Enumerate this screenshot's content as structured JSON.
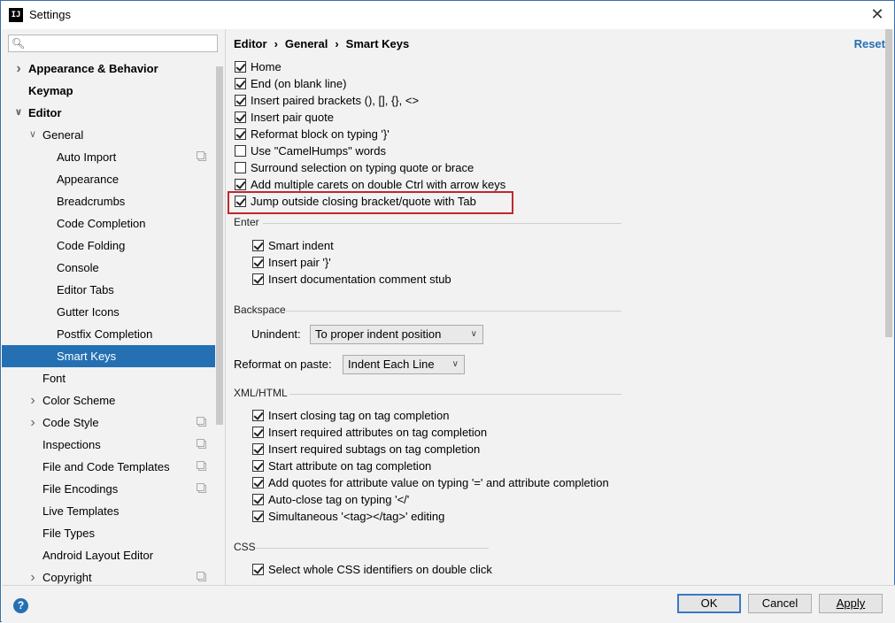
{
  "window": {
    "title": "Settings",
    "app_icon": "IJ"
  },
  "search": {
    "placeholder": "",
    "value": ""
  },
  "sidebar": {
    "items": [
      {
        "label": "Appearance & Behavior",
        "bold": true,
        "level": 0,
        "arrow": "right"
      },
      {
        "label": "Keymap",
        "bold": true,
        "level": 0,
        "arrow": ""
      },
      {
        "label": "Editor",
        "bold": true,
        "level": 0,
        "arrow": "down"
      },
      {
        "label": "General",
        "bold": false,
        "level": 1,
        "arrow": "down"
      },
      {
        "label": "Auto Import",
        "bold": false,
        "level": 2,
        "arrow": "",
        "copy": true
      },
      {
        "label": "Appearance",
        "bold": false,
        "level": 2,
        "arrow": ""
      },
      {
        "label": "Breadcrumbs",
        "bold": false,
        "level": 2,
        "arrow": ""
      },
      {
        "label": "Code Completion",
        "bold": false,
        "level": 2,
        "arrow": ""
      },
      {
        "label": "Code Folding",
        "bold": false,
        "level": 2,
        "arrow": ""
      },
      {
        "label": "Console",
        "bold": false,
        "level": 2,
        "arrow": ""
      },
      {
        "label": "Editor Tabs",
        "bold": false,
        "level": 2,
        "arrow": ""
      },
      {
        "label": "Gutter Icons",
        "bold": false,
        "level": 2,
        "arrow": ""
      },
      {
        "label": "Postfix Completion",
        "bold": false,
        "level": 2,
        "arrow": ""
      },
      {
        "label": "Smart Keys",
        "bold": false,
        "level": 2,
        "arrow": "",
        "selected": true
      },
      {
        "label": "Font",
        "bold": false,
        "level": 1,
        "arrow": ""
      },
      {
        "label": "Color Scheme",
        "bold": false,
        "level": 1,
        "arrow": "right"
      },
      {
        "label": "Code Style",
        "bold": false,
        "level": 1,
        "arrow": "right",
        "copy": true
      },
      {
        "label": "Inspections",
        "bold": false,
        "level": 1,
        "arrow": "",
        "copy": true
      },
      {
        "label": "File and Code Templates",
        "bold": false,
        "level": 1,
        "arrow": "",
        "copy": true
      },
      {
        "label": "File Encodings",
        "bold": false,
        "level": 1,
        "arrow": "",
        "copy": true
      },
      {
        "label": "Live Templates",
        "bold": false,
        "level": 1,
        "arrow": ""
      },
      {
        "label": "File Types",
        "bold": false,
        "level": 1,
        "arrow": ""
      },
      {
        "label": "Android Layout Editor",
        "bold": false,
        "level": 1,
        "arrow": ""
      },
      {
        "label": "Copyright",
        "bold": false,
        "level": 1,
        "arrow": "right",
        "copy": true
      }
    ]
  },
  "breadcrumb": {
    "parts": [
      "Editor",
      "General",
      "Smart Keys"
    ],
    "separator": "›"
  },
  "reset_label": "Reset",
  "options_top": [
    {
      "label": "Home",
      "checked": true
    },
    {
      "label": "End (on blank line)",
      "checked": true
    },
    {
      "label": "Insert paired brackets (), [], {}, <>",
      "checked": true
    },
    {
      "label": "Insert pair quote",
      "checked": true
    },
    {
      "label": "Reformat block on typing '}'",
      "checked": true
    },
    {
      "label": "Use \"CamelHumps\" words",
      "checked": false
    },
    {
      "label": "Surround selection on typing quote or brace",
      "checked": false
    },
    {
      "label": "Add multiple carets on double Ctrl with arrow keys",
      "checked": true
    },
    {
      "label": "Jump outside closing bracket/quote with Tab",
      "checked": true,
      "highlighted": true
    }
  ],
  "enter": {
    "title": "Enter",
    "options": [
      {
        "label": "Smart indent",
        "checked": true
      },
      {
        "label": "Insert pair '}'",
        "checked": true
      },
      {
        "label": "Insert documentation comment stub",
        "checked": true
      }
    ]
  },
  "backspace": {
    "title": "Backspace",
    "unindent_label": "Unindent:",
    "unindent_value": "To proper indent position"
  },
  "reformat": {
    "label": "Reformat on paste:",
    "value": "Indent Each Line"
  },
  "xml": {
    "title": "XML/HTML",
    "options": [
      {
        "label": "Insert closing tag on tag completion",
        "checked": true
      },
      {
        "label": "Insert required attributes on tag completion",
        "checked": true
      },
      {
        "label": "Insert required subtags on tag completion",
        "checked": true
      },
      {
        "label": "Start attribute on tag completion",
        "checked": true
      },
      {
        "label": "Add quotes for attribute value on typing '=' and attribute completion",
        "checked": true
      },
      {
        "label": "Auto-close tag on typing '</'",
        "checked": true
      },
      {
        "label": "Simultaneous '<tag></tag>' editing",
        "checked": true
      }
    ]
  },
  "css": {
    "title": "CSS",
    "options": [
      {
        "label": "Select whole CSS identifiers on double click",
        "checked": true
      }
    ]
  },
  "buttons": {
    "ok": "OK",
    "cancel": "Cancel",
    "apply": "Apply",
    "help": "?"
  }
}
